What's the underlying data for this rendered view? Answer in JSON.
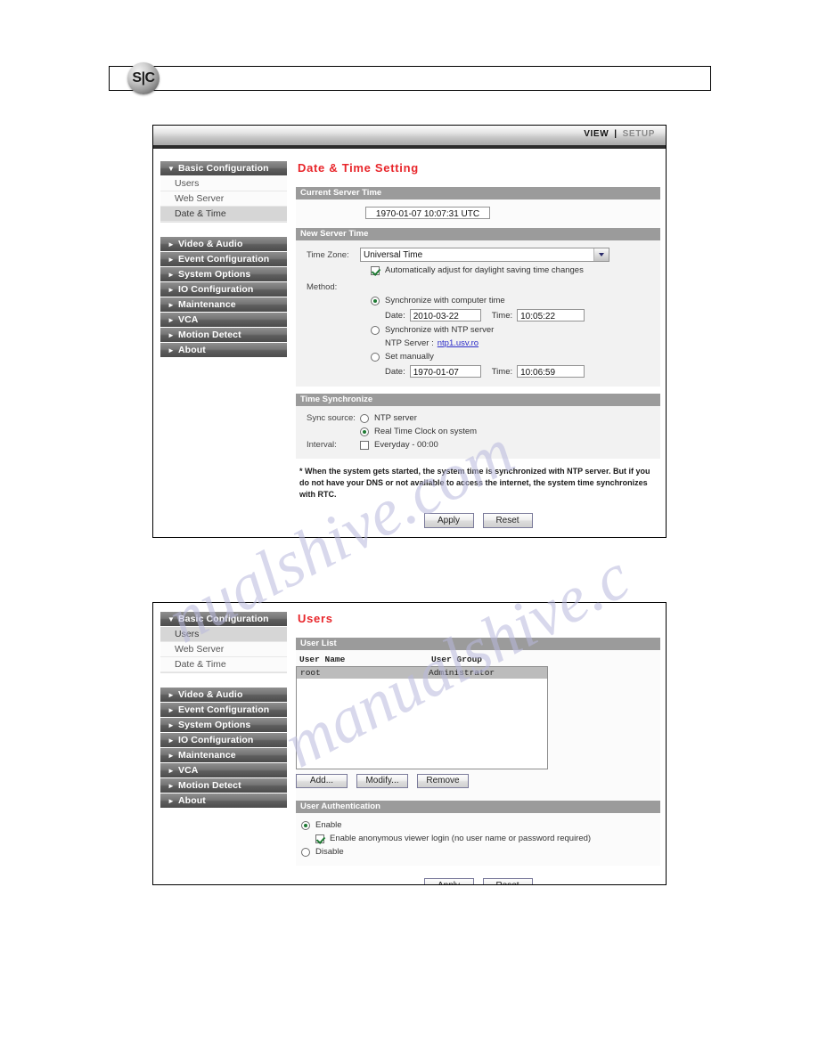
{
  "document": {
    "logo_text": "S|C"
  },
  "watermark": {
    "line1": "nualshive.com",
    "line2": "manualshive.c"
  },
  "topbar": {
    "view_label": "VIEW",
    "separator": "|",
    "setup_label": "SETUP"
  },
  "sidebar": {
    "basic_configuration": {
      "label": "Basic Configuration",
      "triangle": "▼",
      "items": [
        {
          "label": "Users"
        },
        {
          "label": "Web Server"
        },
        {
          "label": "Date & Time"
        }
      ]
    },
    "groups": [
      {
        "label": "Video & Audio",
        "triangle": "►"
      },
      {
        "label": "Event Configuration",
        "triangle": "►"
      },
      {
        "label": "System Options",
        "triangle": "►"
      },
      {
        "label": "IO Configuration",
        "triangle": "►"
      },
      {
        "label": "Maintenance",
        "triangle": "►"
      },
      {
        "label": "VCA",
        "triangle": "►"
      },
      {
        "label": "Motion Detect",
        "triangle": "►"
      },
      {
        "label": "About",
        "triangle": "►"
      }
    ]
  },
  "datetime_page": {
    "title": "Date & Time Setting",
    "current_server_time": {
      "section_label": "Current Server Time",
      "value": "1970-01-07 10:07:31 UTC"
    },
    "new_server_time": {
      "section_label": "New Server Time",
      "timezone_label": "Time Zone:",
      "timezone_value": "Universal Time",
      "dst_label": "Automatically adjust for daylight saving time changes",
      "dst_checked": true,
      "method_label": "Method:",
      "opt_sync_computer": "Synchronize with computer time",
      "sync_computer_selected": true,
      "computer_date_label": "Date:",
      "computer_date_value": "2010-03-22",
      "computer_time_label": "Time:",
      "computer_time_value": "10:05:22",
      "opt_sync_ntp": "Synchronize with NTP server",
      "sync_ntp_selected": false,
      "ntp_server_label": "NTP Server :",
      "ntp_server_link": "ntp1.usv.ro",
      "opt_set_manually": "Set manually",
      "set_manually_selected": false,
      "manual_date_label": "Date:",
      "manual_date_value": "1970-01-07",
      "manual_time_label": "Time:",
      "manual_time_value": "10:06:59"
    },
    "time_synchronize": {
      "section_label": "Time Synchronize",
      "sync_source_label": "Sync source:",
      "opt_ntp_server": "NTP server",
      "ntp_server_selected": false,
      "opt_rtc": "Real Time Clock on system",
      "rtc_selected": true,
      "interval_label": "Interval:",
      "interval_option": "Everyday - 00:00",
      "interval_checked": false
    },
    "note": "* When the system gets started, the system time is synchronized with NTP server. But if you do not have your DNS or not available to access the internet, the system time synchronizes with RTC.",
    "apply_label": "Apply",
    "reset_label": "Reset"
  },
  "users_page": {
    "title": "Users",
    "user_list": {
      "section_label": "User List",
      "columns": [
        "User Name",
        "User Group"
      ],
      "rows": [
        {
          "user_name": "root",
          "user_group": "Administrator"
        }
      ],
      "add_label": "Add...",
      "modify_label": "Modify...",
      "remove_label": "Remove"
    },
    "user_authentication": {
      "section_label": "User Authentication",
      "opt_enable": "Enable",
      "enable_selected": true,
      "anonymous_label": "Enable anonymous viewer login (no user name or password required)",
      "anonymous_checked": true,
      "opt_disable": "Disable",
      "disable_selected": false
    },
    "apply_label": "Apply",
    "reset_label": "Reset"
  },
  "colors": {
    "accent_red": "#e8262b",
    "section_header_gray": "#9b9b9b",
    "nav_group_gray": "#5e5e5e",
    "link_blue": "#2c2cc8"
  }
}
